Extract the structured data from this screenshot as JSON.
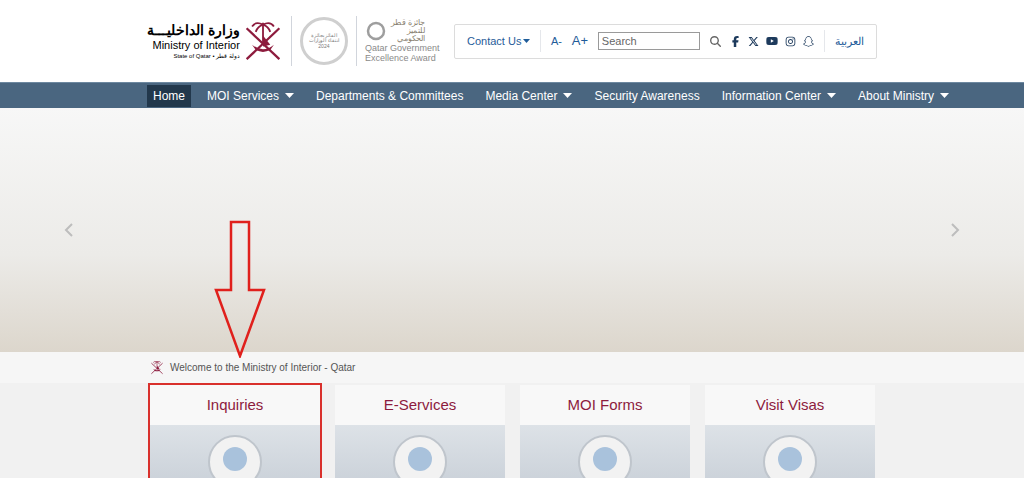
{
  "logo": {
    "arabic": "وزارة الداخليـــة",
    "english": "Ministry of Interior",
    "state": "State of Qatar • دولة قطر"
  },
  "award": {
    "badge_lines": [
      "الفائز بجائزة",
      "انتقاء الوزارات",
      "2024"
    ],
    "arabic_lines": [
      "جائزة قطر",
      "للتميز",
      "الحكومي"
    ],
    "english_lines": [
      "Qatar Government",
      "Excellence Award"
    ]
  },
  "toolbar": {
    "contact": "Contact Us",
    "font_smaller": "A-",
    "font_larger": "A+",
    "search": {
      "placeholder": "Search"
    },
    "language": "العربية"
  },
  "nav": [
    {
      "label": "Home",
      "selected": true,
      "has_menu": false
    },
    {
      "label": "MOI Services",
      "selected": false,
      "has_menu": true
    },
    {
      "label": "Departments & Committees",
      "selected": false,
      "has_menu": false
    },
    {
      "label": "Media Center",
      "selected": false,
      "has_menu": true
    },
    {
      "label": "Security Awareness",
      "selected": false,
      "has_menu": false
    },
    {
      "label": "Information Center",
      "selected": false,
      "has_menu": true
    },
    {
      "label": "About Ministry",
      "selected": false,
      "has_menu": true
    }
  ],
  "welcome": "Welcome to the Ministry of Interior - Qatar",
  "cards": [
    {
      "title": "Inquiries",
      "highlighted": true
    },
    {
      "title": "E-Services",
      "highlighted": false
    },
    {
      "title": "MOI Forms",
      "highlighted": false
    },
    {
      "title": "Visit Visas",
      "highlighted": false
    }
  ]
}
